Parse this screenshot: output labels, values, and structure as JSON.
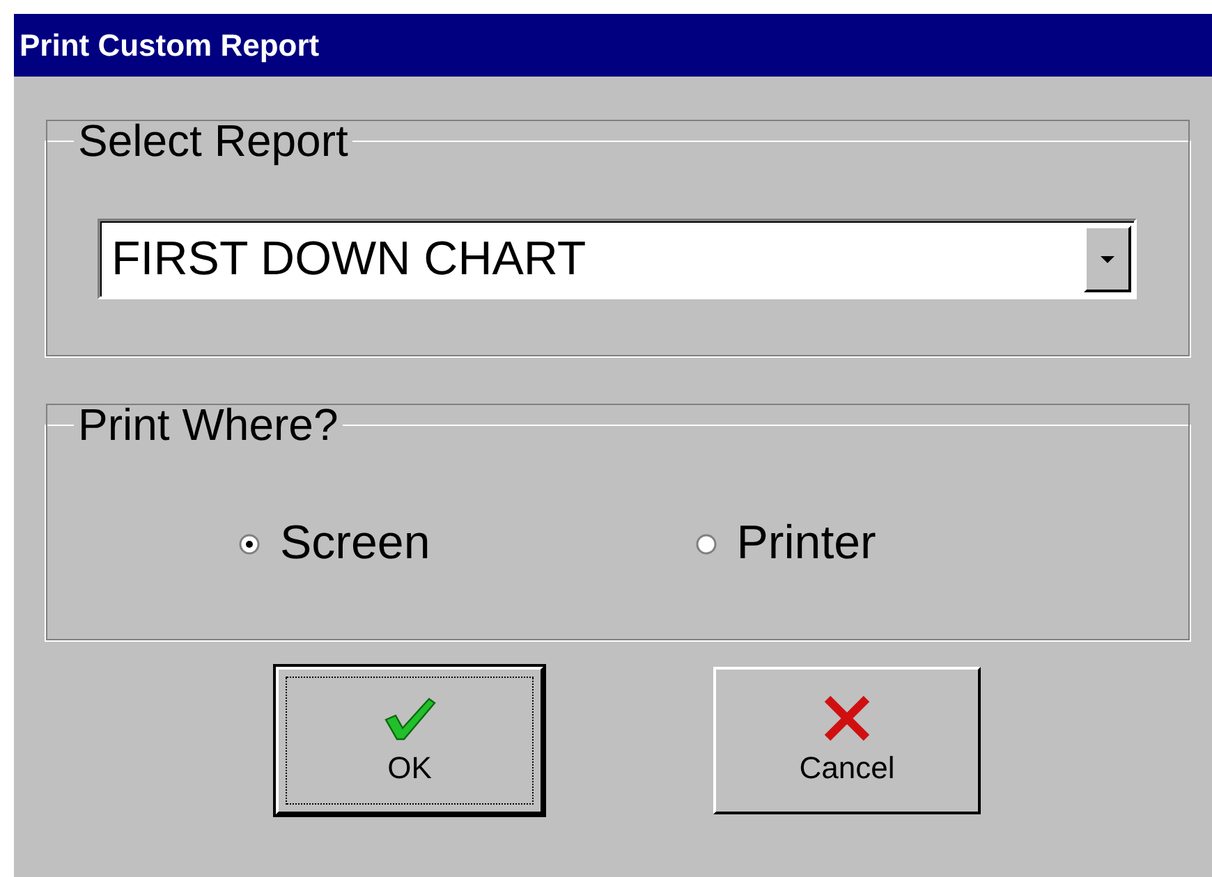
{
  "window": {
    "title": "Print Custom Report"
  },
  "report_group": {
    "legend": "Select Report",
    "dropdown": {
      "value": "FIRST DOWN CHART"
    }
  },
  "destination_group": {
    "legend": "Print Where?",
    "options": [
      {
        "label": "Screen",
        "selected": true
      },
      {
        "label": "Printer",
        "selected": false
      }
    ]
  },
  "buttons": [
    {
      "label": "OK",
      "kind": "ok",
      "focused": true
    },
    {
      "label": "Cancel",
      "kind": "cancel",
      "focused": false
    }
  ]
}
